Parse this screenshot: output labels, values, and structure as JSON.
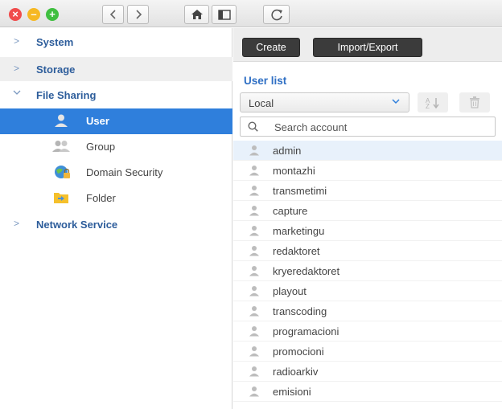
{
  "toolbar": {
    "close": "×",
    "minimize": "–",
    "maximize": "+",
    "back_icon": "chevron-left-icon",
    "forward_icon": "chevron-right-icon",
    "home_icon": "home-icon",
    "layout_icon": "sidebar-toggle-icon",
    "refresh_icon": "refresh-icon"
  },
  "sidebar": {
    "sections": [
      {
        "label": "System",
        "expanded": false
      },
      {
        "label": "Storage",
        "expanded": false
      },
      {
        "label": "File Sharing",
        "expanded": true
      },
      {
        "label": "Network Service",
        "expanded": false
      }
    ],
    "file_sharing_items": [
      {
        "label": "User",
        "icon": "user-icon",
        "active": true
      },
      {
        "label": "Group",
        "icon": "group-icon",
        "active": false
      },
      {
        "label": "Domain Security",
        "icon": "domain-security-icon",
        "active": false
      },
      {
        "label": "Folder",
        "icon": "folder-icon",
        "active": false
      }
    ]
  },
  "main": {
    "create_label": "Create",
    "import_export_label": "Import/Export",
    "section_title": "User list",
    "source_select": "Local",
    "sort_icon": "sort-az-icon",
    "delete_icon": "trash-icon",
    "search_placeholder": "Search account",
    "users": [
      "admin",
      "montazhi",
      "transmetimi",
      "capture",
      "marketingu",
      "redaktoret",
      "kryeredaktoret",
      "playout",
      "transcoding",
      "programacioni",
      "promocioni",
      "radioarkiv",
      "emisioni"
    ],
    "selected_user": "admin"
  },
  "colors": {
    "accent": "#2f7fdc",
    "nav_text": "#2d5d9b",
    "button_dark": "#3b3b3b"
  }
}
